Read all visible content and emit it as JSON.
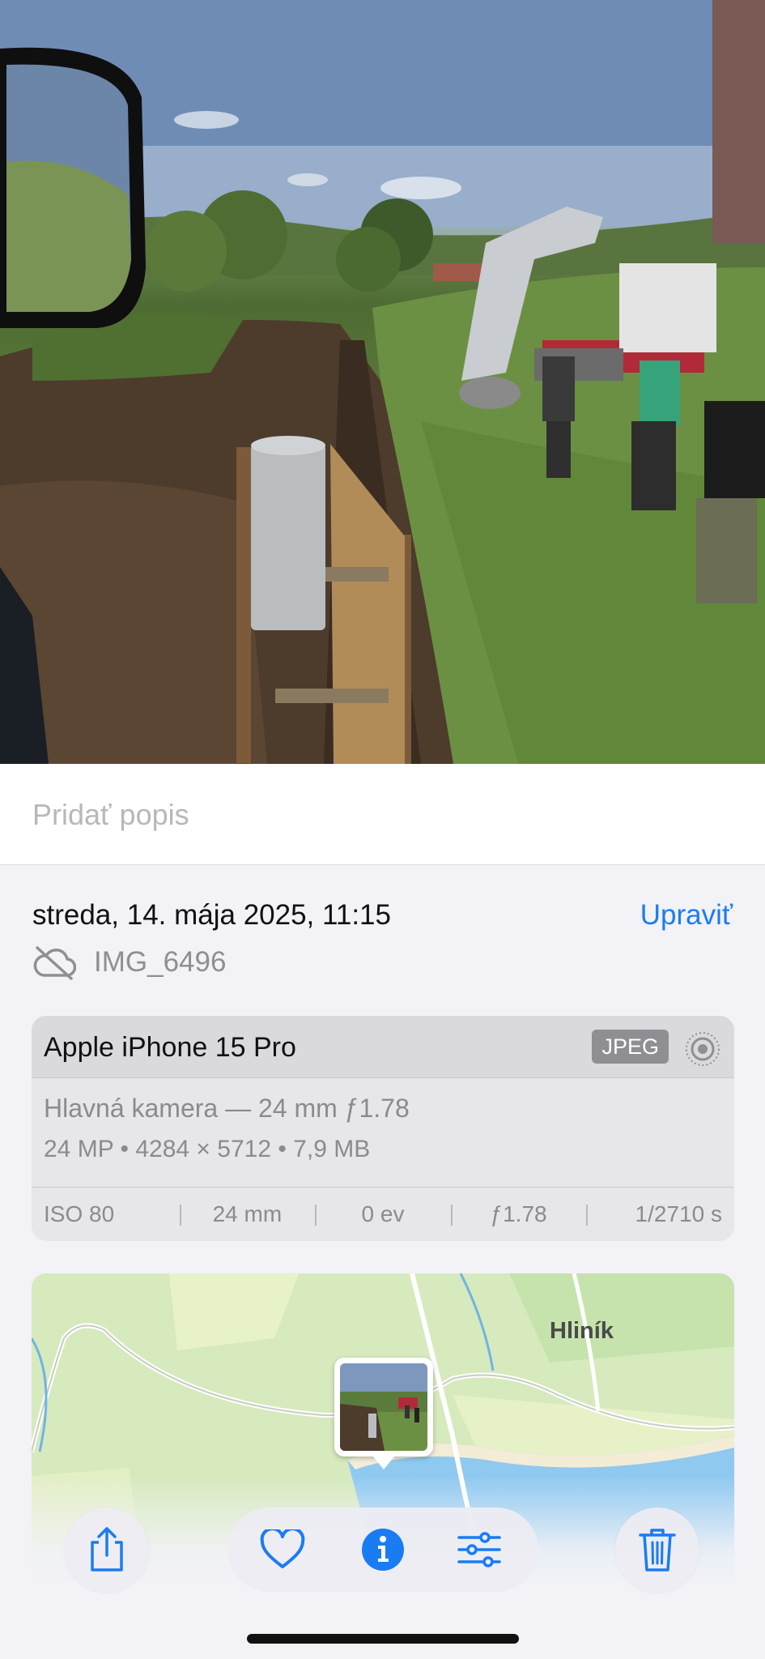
{
  "photo": {
    "alt_icon": "photo-thumbnail"
  },
  "caption": {
    "placeholder": "Pridať popis"
  },
  "meta": {
    "date": "streda, 14. mája 2025, 11:15",
    "edit_label": "Upraviť",
    "file_name": "IMG_6496",
    "cloud_icon": "cloud-off-icon"
  },
  "device": {
    "name": "Apple iPhone 15 Pro",
    "format": "JPEG",
    "lens": "Hlavná kamera — 24 mm ƒ1.78",
    "specs": "24 MP • 4284 × 5712 • 7,9 MB",
    "exif": [
      "ISO 80",
      "24 mm",
      "0 ev",
      "ƒ1.78",
      "1/2710 s"
    ]
  },
  "map": {
    "place_label": "Hliník"
  },
  "toolbar": {
    "share": "share-icon",
    "favorite": "heart-icon",
    "info": "info-icon",
    "adjust": "sliders-icon",
    "delete": "trash-icon",
    "accent": "#1a7cf2"
  }
}
